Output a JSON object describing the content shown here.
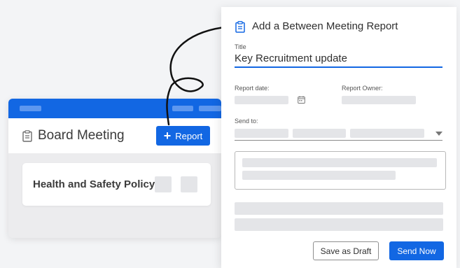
{
  "background_window": {
    "title": "Board Meeting",
    "title_icon": "clipboard-icon",
    "report_button": {
      "label": "Report",
      "icon": "plus-icon"
    },
    "agenda_item": {
      "label": "Health and Safety Policy"
    }
  },
  "panel": {
    "title": "Add a Between Meeting Report",
    "title_icon": "clipboard-icon",
    "fields": {
      "title_label": "Title",
      "title_value": "Key Recruitment update",
      "report_date_label": "Report date:",
      "report_owner_label": "Report Owner:",
      "send_to_label": "Send to:"
    },
    "buttons": {
      "save_draft": "Save as Draft",
      "send_now": "Send Now"
    }
  },
  "colors": {
    "accent": "#1267e3",
    "placeholder": "#e4e5e8"
  }
}
